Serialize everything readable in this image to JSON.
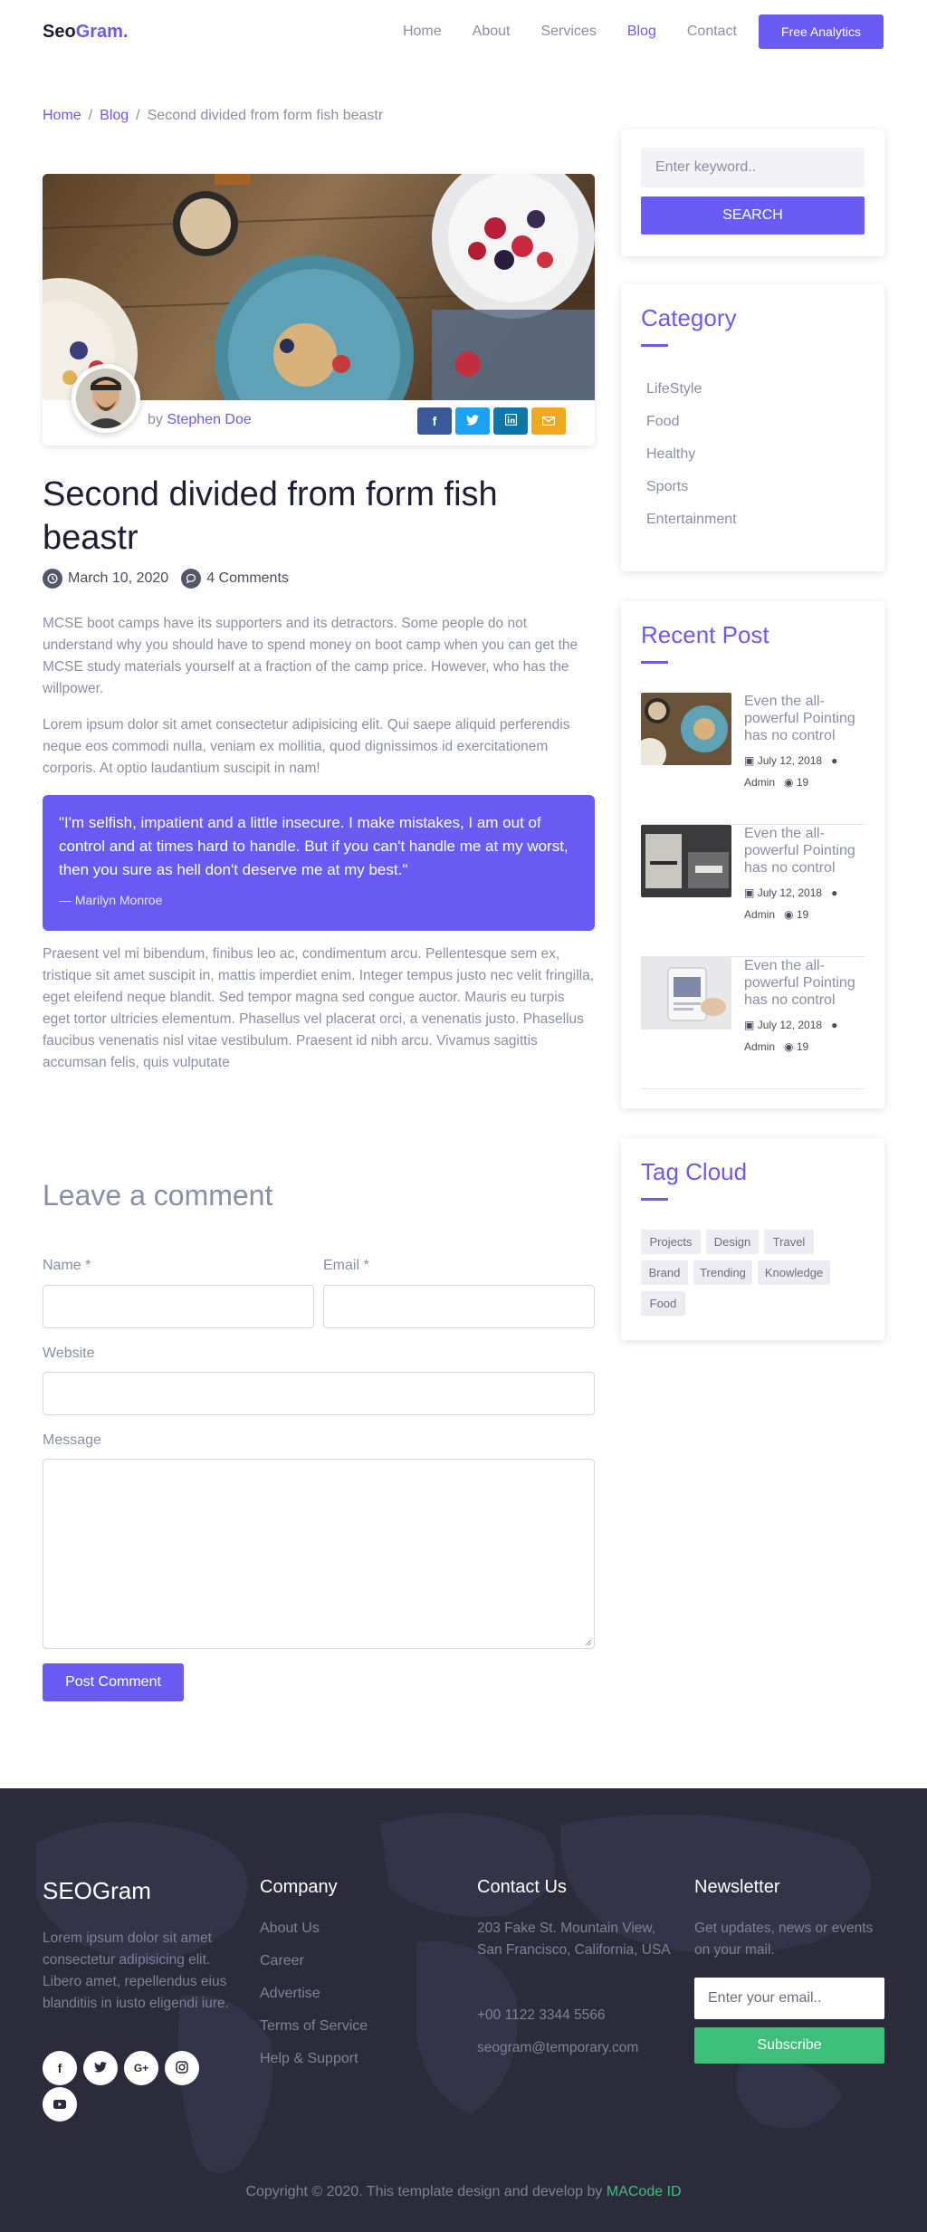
{
  "header": {
    "logo_main": "Seo",
    "logo_accent": "Gram.",
    "nav": [
      "Home",
      "About",
      "Services",
      "Blog",
      "Contact"
    ],
    "cta": "Free Analytics"
  },
  "breadcrumb": {
    "home": "Home",
    "blog": "Blog",
    "current": "Second divided from form fish beastr"
  },
  "post": {
    "author_prefix": "by",
    "author": "Stephen Doe",
    "title": "Second divided from form fish beastr",
    "date": "March 10, 2020",
    "comments": "4 Comments",
    "paragraph1": "MCSE boot camps have its supporters and its detractors. Some people do not understand why you should have to spend money on boot camp when you can get the MCSE study materials yourself at a fraction of the camp price. However, who has the willpower.",
    "paragraph2": "Lorem ipsum dolor sit amet consectetur adipisicing elit. Qui saepe aliquid perferendis neque eos commodi nulla, veniam ex mollitia, quod dignissimos id exercitationem corporis. At optio laudantium suscipit in nam!",
    "quote": "\"I'm selfish, impatient and a little insecure. I make mistakes, I am out of control and at times hard to handle. But if you can't handle me at my worst, then you sure as hell don't deserve me at my best.\"",
    "quote_author": "— Marilyn Monroe",
    "paragraph3": "Praesent vel mi bibendum, finibus leo ac, condimentum arcu. Pellentesque sem ex, tristique sit amet suscipit in, mattis imperdiet enim. Integer tempus justo nec velit fringilla, eget eleifend neque blandit. Sed tempor magna sed congue auctor. Mauris eu turpis eget tortor ultricies elementum. Phasellus vel placerat orci, a venenatis justo. Phasellus faucibus venenatis nisl vitae vestibulum. Praesent id nibh arcu. Vivamus sagittis accumsan felis, quis vulputate",
    "share_icons": [
      "facebook-icon",
      "twitter-icon",
      "linkedin-icon",
      "mail-icon"
    ]
  },
  "comment_form": {
    "title": "Leave a comment",
    "name_label": "Name *",
    "email_label": "Email *",
    "website_label": "Website",
    "message_label": "Message",
    "submit": "Post Comment"
  },
  "sidebar": {
    "search_placeholder": "Enter keyword..",
    "search_button": "SEARCH",
    "category_title": "Category",
    "categories": [
      "LifeStyle",
      "Food",
      "Healthy",
      "Sports",
      "Entertainment"
    ],
    "recent_title": "Recent Post",
    "recent_posts": [
      {
        "title": "Even the all-powerful Pointing has no control",
        "date": "July 12, 2018",
        "author": "Admin",
        "comments": "19"
      },
      {
        "title": "Even the all-powerful Pointing has no control",
        "date": "July 12, 2018",
        "author": "Admin",
        "comments": "19"
      },
      {
        "title": "Even the all-powerful Pointing has no control",
        "date": "July 12, 2018",
        "author": "Admin",
        "comments": "19"
      }
    ],
    "tag_title": "Tag Cloud",
    "tags": [
      "Projects",
      "Design",
      "Travel",
      "Brand",
      "Trending",
      "Knowledge",
      "Food"
    ]
  },
  "footer": {
    "brand": "SEOGram",
    "about": "Lorem ipsum dolor sit amet consectetur adipisicing elit. Libero amet, repellendus eius blanditiis in iusto eligendi iure.",
    "social_icons": [
      "facebook-icon",
      "twitter-icon",
      "google-plus-icon",
      "instagram-icon",
      "youtube-icon"
    ],
    "company_title": "Company",
    "company_links": [
      "About Us",
      "Career",
      "Advertise",
      "Terms of Service",
      "Help & Support"
    ],
    "contact_title": "Contact Us",
    "address": "203 Fake St. Mountain View, San Francisco, California, USA",
    "phone": "+00 1122 3344 5566",
    "email": "seogram@temporary.com",
    "newsletter_title": "Newsletter",
    "newsletter_text": "Get updates, news or events on your mail.",
    "newsletter_placeholder": "Enter your email..",
    "newsletter_button": "Subscribe",
    "copyright_prefix": "Copyright © 2020. This template design and develop by",
    "copyright_link": "MACode ID"
  },
  "colors": {
    "accent": "#6b5bf5",
    "footer_bg": "#2b2b3c",
    "subscribe": "#3ec07a",
    "facebook": "#3b5998",
    "twitter": "#1da1f2",
    "linkedin": "#0e76a8",
    "mail": "#f0a81e"
  }
}
